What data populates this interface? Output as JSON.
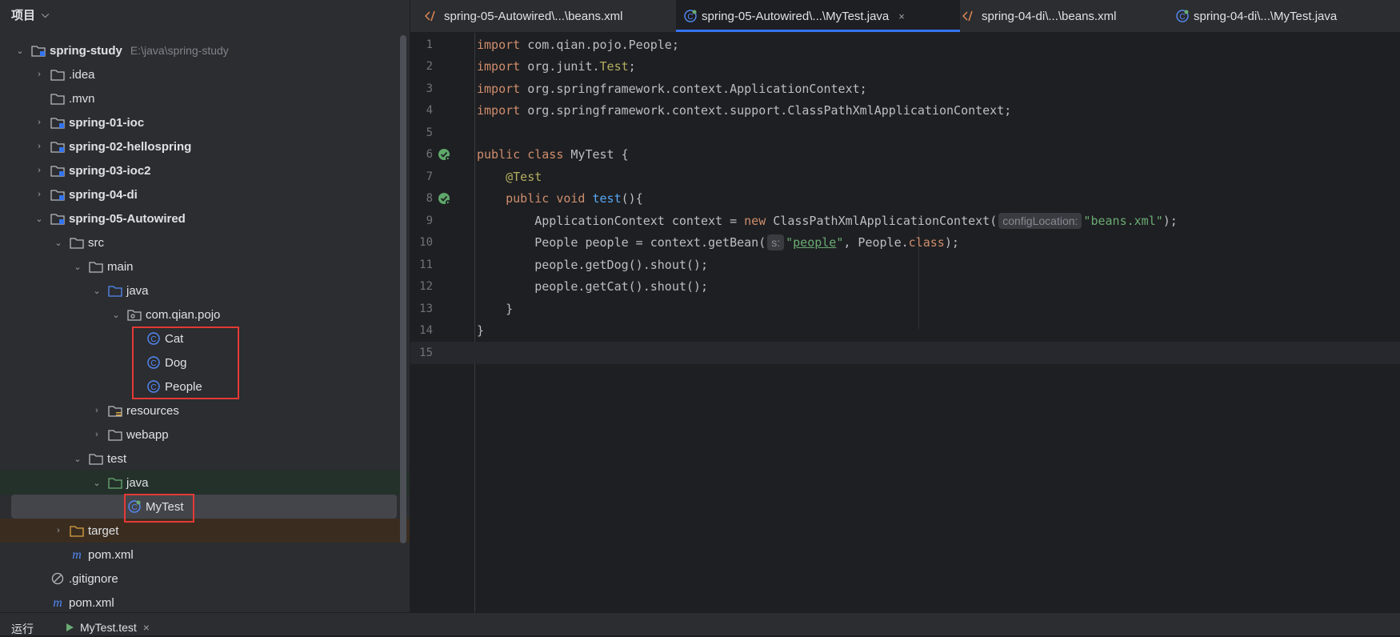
{
  "sidebar": {
    "title": "项目",
    "tree": [
      {
        "label": "spring-study",
        "path": "E:\\java\\spring-study"
      },
      {
        "label": ".idea"
      },
      {
        "label": ".mvn"
      },
      {
        "label": "spring-01-ioc"
      },
      {
        "label": "spring-02-hellospring"
      },
      {
        "label": "spring-03-ioc2"
      },
      {
        "label": "spring-04-di"
      },
      {
        "label": "spring-05-Autowired"
      },
      {
        "label": "src"
      },
      {
        "label": "main"
      },
      {
        "label": "java"
      },
      {
        "label": "com.qian.pojo"
      },
      {
        "label": "Cat"
      },
      {
        "label": "Dog"
      },
      {
        "label": "People"
      },
      {
        "label": "resources"
      },
      {
        "label": "webapp"
      },
      {
        "label": "test"
      },
      {
        "label": "java"
      },
      {
        "label": "MyTest"
      },
      {
        "label": "target"
      },
      {
        "label": "pom.xml"
      },
      {
        "label": ".gitignore"
      },
      {
        "label": "pom.xml"
      }
    ]
  },
  "tabs": [
    {
      "label": "spring-05-Autowired\\...\\beans.xml"
    },
    {
      "label": "spring-05-Autowired\\...\\MyTest.java",
      "close": "×"
    },
    {
      "label": "spring-04-di\\...\\beans.xml"
    },
    {
      "label": "spring-04-di\\...\\MyTest.java"
    }
  ],
  "editor": {
    "line_numbers": [
      "1",
      "2",
      "3",
      "4",
      "5",
      "6",
      "7",
      "8",
      "9",
      "10",
      "11",
      "12",
      "13",
      "14",
      "15"
    ],
    "lines": {
      "l1": {
        "kw": "import",
        "rest": " com.qian.pojo.People;"
      },
      "l2": {
        "kw": "import",
        "rest": " org.junit.",
        "ann": "Test",
        "end": ";"
      },
      "l3": {
        "kw": "import",
        "rest": " org.springframework.context.ApplicationContext;"
      },
      "l4": {
        "kw": "import",
        "rest": " org.springframework.context.support.ClassPathXmlApplicationContext;"
      },
      "l6": {
        "kw1": "public",
        "kw2": "class",
        "rest": " MyTest {"
      },
      "l7": {
        "ann": "@Test"
      },
      "l8": {
        "kw1": "public",
        "kw2": "void",
        "fn": "test",
        "rest": "(){"
      },
      "l9": {
        "pre": "ApplicationContext context = ",
        "kw": "new",
        "mid": " ClassPathXmlApplicationContext(",
        "hint": "configLocation:",
        "str": "\"beans.xml\"",
        "end": ");"
      },
      "l10": {
        "pre": "People people = context.getBean(",
        "hint": "s:",
        "q1": "\"",
        "str": "people",
        "q2": "\"",
        "mid": ", People.",
        "kw": "class",
        "end": ");"
      },
      "l11": {
        "code": "people.getDog().shout();"
      },
      "l12": {
        "code": "people.getCat().shout();"
      },
      "l13": {
        "code": "}"
      },
      "l14": {
        "code": "}"
      }
    }
  },
  "bottom": {
    "run_label": "运行",
    "run_tab": "MyTest.test",
    "run_tab_close": "×"
  },
  "colors": {
    "accent": "#3574f0",
    "highlight_box": "#e53935"
  }
}
